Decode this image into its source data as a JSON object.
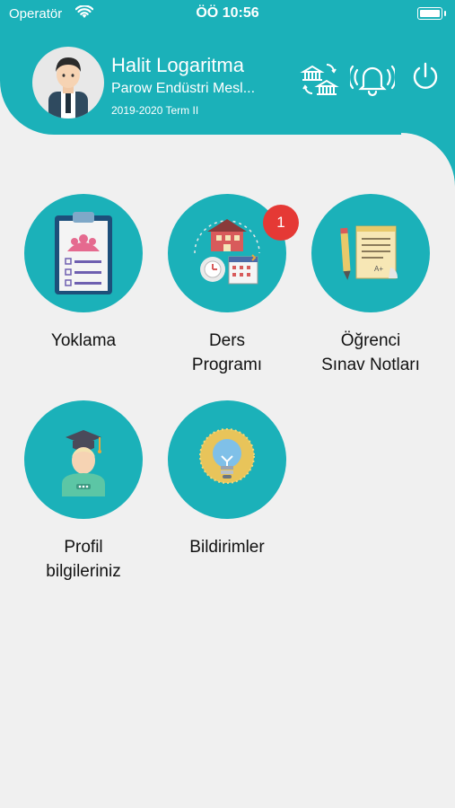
{
  "status_bar": {
    "carrier": "Operatör",
    "time": "ÖÖ 10:56"
  },
  "user": {
    "name": "Halit Logaritma",
    "school": "Parow Endüstri Mesl...",
    "term": "2019-2020 Term II"
  },
  "header_icons": [
    "switch-school-icon",
    "bell-icon",
    "power-icon"
  ],
  "menu": [
    {
      "label_line1": "Yoklama",
      "label_line2": "",
      "icon": "clipboard-attendance-icon"
    },
    {
      "label_line1": "Ders",
      "label_line2": "Programı",
      "icon": "schedule-icon",
      "badge": "1"
    },
    {
      "label_line1": "Öğrenci",
      "label_line2": "Sınav Notları",
      "icon": "exam-notes-icon"
    },
    {
      "label_line1": "Profil",
      "label_line2": "bilgileriniz",
      "icon": "graduate-profile-icon"
    },
    {
      "label_line1": "Bildirimler",
      "label_line2": "",
      "icon": "lightbulb-icon"
    }
  ],
  "colors": {
    "accent": "#1bb1b9",
    "badge": "#e53935",
    "background": "#f0f0f0"
  }
}
